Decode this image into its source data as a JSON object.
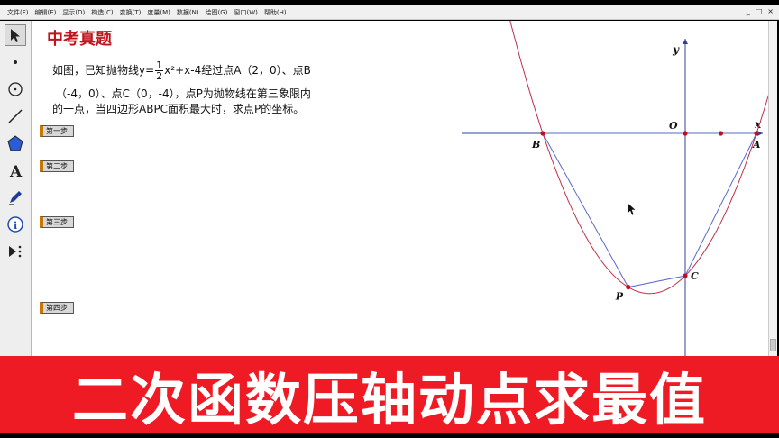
{
  "menu": {
    "items": [
      "文件(F)",
      "编辑(E)",
      "显示(D)",
      "构造(C)",
      "变换(T)",
      "度量(M)",
      "数据(N)",
      "绘图(G)",
      "窗口(W)",
      "帮助(H)"
    ],
    "window_controls": [
      "_",
      "□",
      "×"
    ]
  },
  "toolbar": {
    "tools": [
      {
        "name": "arrow-tool",
        "glyph": "↖"
      },
      {
        "name": "point-tool",
        "glyph": "•"
      },
      {
        "name": "compass-tool",
        "glyph": "⊙"
      },
      {
        "name": "straightedge-tool",
        "glyph": "/"
      },
      {
        "name": "polygon-tool",
        "glyph": "⬟"
      },
      {
        "name": "text-tool",
        "glyph": "A"
      },
      {
        "name": "marker-tool",
        "glyph": "✎"
      },
      {
        "name": "info-tool",
        "glyph": "ⓘ"
      },
      {
        "name": "custom-tool",
        "glyph": "▶⋮"
      }
    ]
  },
  "problem": {
    "title": "中考真题",
    "line1_pre": "如图，已知抛物线y=",
    "frac_num": "1",
    "frac_den": "2",
    "line1_post": "x²+x-4经过点A（2，0）、点B",
    "line2": "（-4，0）、点C（0，-4），点P为抛物线在第三象限内",
    "line3": "的一点，当四边形ABPC面积最大时，求点P的坐标。"
  },
  "steps": [
    "第一步",
    "第二步",
    "第三步",
    "第四步"
  ],
  "graph": {
    "axis_x_label": "x",
    "axis_y_label": "y",
    "origin_label": "O",
    "points": {
      "A": [
        2,
        0
      ],
      "B": [
        -4,
        0
      ],
      "C": [
        0,
        -4
      ],
      "P": [
        -1.6,
        -4.32
      ]
    },
    "extra_points_on_x_axis": [
      1
    ],
    "labels": {
      "A": "A",
      "B": "B",
      "C": "C",
      "P": "P"
    },
    "curve_color": "#c0304a",
    "quad_color": "#5a6ac8",
    "point_color": "#c01020",
    "axis_color": "#3040a0"
  },
  "banner": {
    "text": "二次函数压轴动点求最值",
    "color": "#ee1a24"
  }
}
